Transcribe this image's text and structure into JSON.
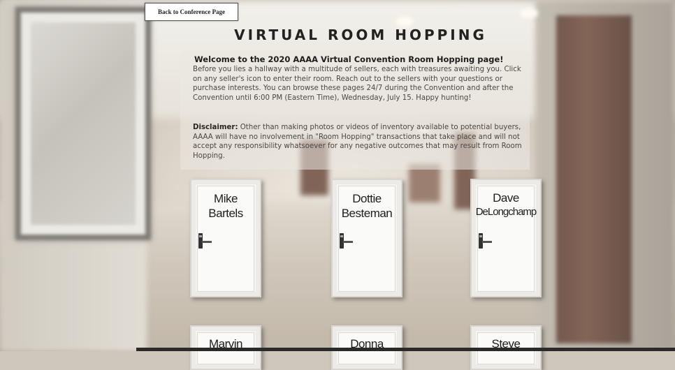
{
  "header": {
    "back_button_label": "Back to Conference Page",
    "title": "VIRTUAL ROOM HOPPING"
  },
  "info": {
    "welcome": "Welcome to the 2020 AAAA Virtual Convention Room Hopping page!",
    "intro": "Before you lies a hallway with a multitude of sellers, each with treasures awaiting you. Click on any seller's icon to enter their room.  Reach out to the sellers with your questions or purchase interests.  You can browse these pages 24/7 during the Convention and after the Convention until 6:00 PM (Eastern Time), Wednesday, July 15. Happy hunting!",
    "disclaimer_label": "Disclaimer:",
    "disclaimer_text": " Other than making photos or videos of inventory available to potential buyers, AAAA will have no involvement in \"Room Hopping\" transactions that take place and will not accept any responsibility whatsoever for any negative outcomes that may result from Room Hopping."
  },
  "doors": [
    {
      "line1": "Mike",
      "line2": "Bartels"
    },
    {
      "line1": "Dottie",
      "line2": "Besteman"
    },
    {
      "line1": "Dave",
      "line2": "DeLongchamp"
    },
    {
      "line1": "Marvin",
      "line2": ""
    },
    {
      "line1": "Donna",
      "line2": ""
    },
    {
      "line1": "Steve",
      "line2": ""
    }
  ]
}
